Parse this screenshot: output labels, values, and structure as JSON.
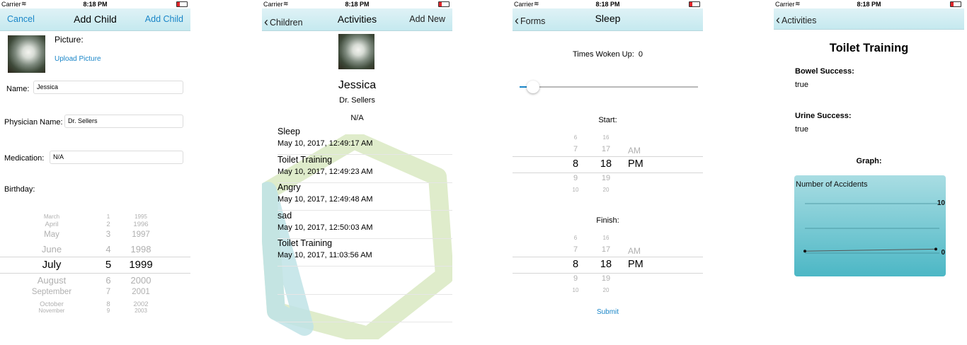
{
  "status": {
    "carrier": "Carrier",
    "time": "8:18 PM"
  },
  "add_child": {
    "nav": {
      "cancel": "Cancel",
      "title": "Add Child",
      "add": "Add Child"
    },
    "picture_label": "Picture:",
    "upload_label": "Upload Picture",
    "name_label": "Name:",
    "name_value": "Jessica",
    "physician_label": "Physician Name:",
    "physician_value": "Dr. Sellers",
    "medication_label": "Medication:",
    "medication_value": "N/A",
    "birthday_label": "Birthday:",
    "birthday_picker": {
      "months": [
        "March",
        "April",
        "May",
        "June",
        "July",
        "August",
        "September",
        "October",
        "November"
      ],
      "days": [
        "1",
        "2",
        "3",
        "4",
        "5",
        "6",
        "7",
        "8",
        "9"
      ],
      "years": [
        "1995",
        "1996",
        "1997",
        "1998",
        "1999",
        "2000",
        "2001",
        "2002",
        "2003"
      ],
      "selected_index": 4
    }
  },
  "activities": {
    "nav": {
      "back": "Children",
      "title": "Activities",
      "add": "Add New"
    },
    "child_name": "Jessica",
    "physician": "Dr. Sellers",
    "medication": "N/A",
    "items": [
      {
        "title": "Sleep",
        "time": "May 10, 2017, 12:49:17 AM"
      },
      {
        "title": "Toilet Training",
        "time": "May 10, 2017, 12:49:23 AM"
      },
      {
        "title": "Angry",
        "time": "May 10, 2017, 12:49:48 AM"
      },
      {
        "title": "sad",
        "time": "May 10, 2017, 12:50:03 AM"
      },
      {
        "title": "Toilet Training",
        "time": "May 10, 2017, 11:03:56 AM"
      }
    ]
  },
  "sleep": {
    "nav": {
      "back": "Forms",
      "title": "Sleep"
    },
    "woken_label": "Times Woken Up:",
    "woken_value": "0",
    "slider_value": 0,
    "start_label": "Start:",
    "finish_label": "Finish:",
    "time_picker": {
      "hours": [
        "6",
        "7",
        "8",
        "9",
        "10"
      ],
      "minutes": [
        "16",
        "17",
        "18",
        "19",
        "20"
      ],
      "ampm": [
        "AM",
        "PM"
      ],
      "selected_hour": "8",
      "selected_minute": "18",
      "selected_ampm": "PM"
    },
    "submit": "Submit"
  },
  "toilet": {
    "nav": {
      "back": "Activities"
    },
    "title": "Toilet Training",
    "bowel_label": "Bowel Success:",
    "bowel_value": "true",
    "urine_label": "Urine Success:",
    "urine_value": "true",
    "graph_label": "Graph:",
    "chart_data": {
      "type": "line",
      "title": "Number of Accidents",
      "y_ticks": [
        "10",
        "0"
      ],
      "ylim": [
        0,
        10
      ],
      "x": [
        0,
        1
      ],
      "values": [
        0.4,
        0.8
      ],
      "colors": {
        "top": "#a9dde3",
        "bottom": "#4cb7c5"
      }
    }
  }
}
